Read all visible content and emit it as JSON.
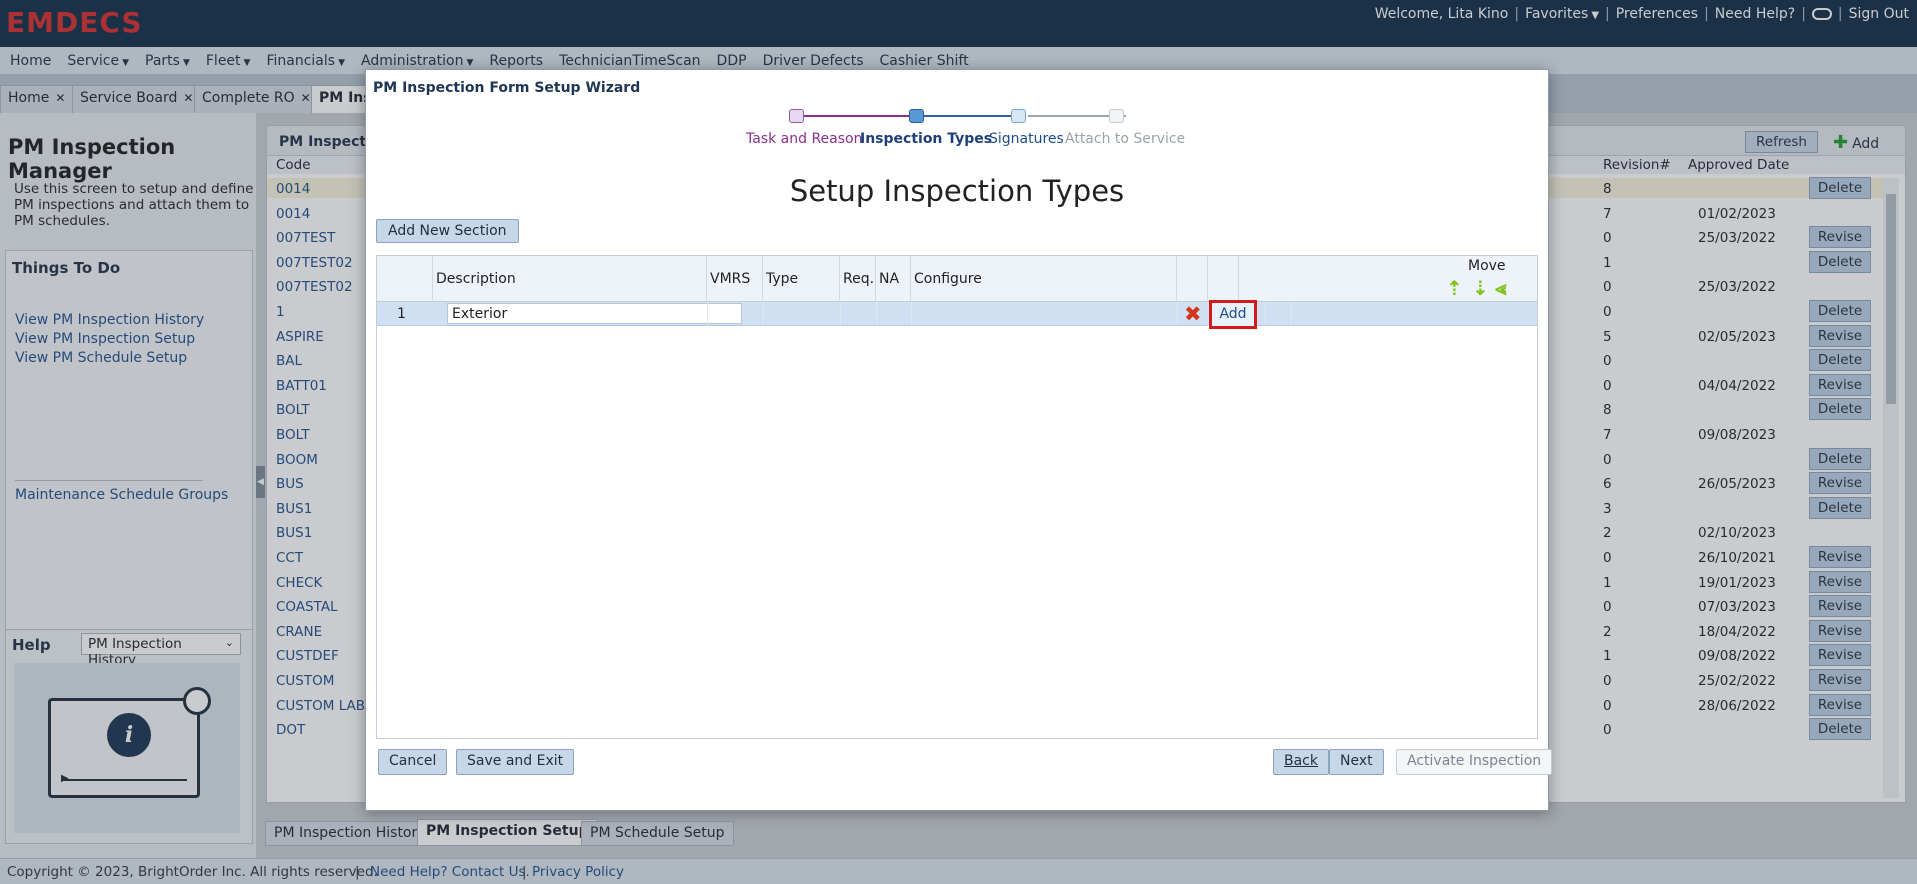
{
  "header": {
    "logo": "EMDECS",
    "welcome": "Welcome, Lita Kino",
    "favorites": "Favorites",
    "preferences": "Preferences",
    "need_help": "Need Help?",
    "sign_out": "Sign Out"
  },
  "menu": [
    {
      "label": "Home",
      "dropdown": false
    },
    {
      "label": "Service",
      "dropdown": true
    },
    {
      "label": "Parts",
      "dropdown": true
    },
    {
      "label": "Fleet",
      "dropdown": true
    },
    {
      "label": "Financials",
      "dropdown": true
    },
    {
      "label": "Administration",
      "dropdown": true
    },
    {
      "label": "Reports",
      "dropdown": false
    },
    {
      "label": "TechnicianTimeScan",
      "dropdown": false
    },
    {
      "label": "DDP",
      "dropdown": false
    },
    {
      "label": "Driver Defects",
      "dropdown": false
    },
    {
      "label": "Cashier Shift",
      "dropdown": false
    }
  ],
  "tabs": [
    {
      "label": "Home"
    },
    {
      "label": "Service Board"
    },
    {
      "label": "Complete RO"
    },
    {
      "label": "PM Ins"
    }
  ],
  "left": {
    "title": "PM Inspection Manager",
    "description": "Use this screen to setup and define PM inspections and attach them to PM schedules.",
    "things_to_do": "Things To Do",
    "links": [
      "View PM Inspection History",
      "View PM Inspection Setup",
      "View PM Schedule Setup"
    ],
    "extra_link": "Maintenance Schedule Groups",
    "help_label": "Help",
    "help_select": "PM Inspection History"
  },
  "right": {
    "title": "PM Inspecti",
    "refresh": "Refresh",
    "add": "Add",
    "col_code": "Code",
    "col_revision": "Revision#",
    "col_approved": "Approved Date",
    "rows": [
      {
        "code": "0014",
        "rev": "8",
        "date": "",
        "btn": "Delete"
      },
      {
        "code": "0014",
        "rev": "7",
        "date": "01/02/2023",
        "btn": ""
      },
      {
        "code": "007TEST",
        "rev": "0",
        "date": "25/03/2022",
        "btn": "Revise"
      },
      {
        "code": "007TEST02",
        "rev": "1",
        "date": "",
        "btn": "Delete"
      },
      {
        "code": "007TEST02",
        "rev": "0",
        "date": "25/03/2022",
        "btn": ""
      },
      {
        "code": "1",
        "rev": "0",
        "date": "",
        "btn": "Delete"
      },
      {
        "code": "ASPIRE",
        "rev": "5",
        "date": "02/05/2023",
        "btn": "Revise"
      },
      {
        "code": "BAL",
        "rev": "0",
        "date": "",
        "btn": "Delete"
      },
      {
        "code": "BATT01",
        "rev": "0",
        "date": "04/04/2022",
        "btn": "Revise"
      },
      {
        "code": "BOLT",
        "rev": "8",
        "date": "",
        "btn": "Delete"
      },
      {
        "code": "BOLT",
        "rev": "7",
        "date": "09/08/2023",
        "btn": ""
      },
      {
        "code": "BOOM",
        "rev": "0",
        "date": "",
        "btn": "Delete"
      },
      {
        "code": "BUS",
        "rev": "6",
        "date": "26/05/2023",
        "btn": "Revise"
      },
      {
        "code": "BUS1",
        "rev": "3",
        "date": "",
        "btn": "Delete"
      },
      {
        "code": "BUS1",
        "rev": "2",
        "date": "02/10/2023",
        "btn": ""
      },
      {
        "code": "CCT",
        "rev": "0",
        "date": "26/10/2021",
        "btn": "Revise"
      },
      {
        "code": "CHECK",
        "rev": "1",
        "date": "19/01/2023",
        "btn": "Revise"
      },
      {
        "code": "COASTAL",
        "rev": "0",
        "date": "07/03/2023",
        "btn": "Revise"
      },
      {
        "code": "CRANE",
        "rev": "2",
        "date": "18/04/2022",
        "btn": "Revise"
      },
      {
        "code": "CUSTDEF",
        "rev": "1",
        "date": "09/08/2022",
        "btn": "Revise"
      },
      {
        "code": "CUSTOM",
        "rev": "0",
        "date": "25/02/2022",
        "btn": "Revise"
      },
      {
        "code": "CUSTOM LABO",
        "rev": "0",
        "date": "28/06/2022",
        "btn": "Revise"
      },
      {
        "code": "DOT",
        "rev": "0",
        "date": "",
        "btn": "Delete"
      }
    ]
  },
  "bottom_tabs": [
    "PM Inspection History",
    "PM Inspection Setup",
    "PM Schedule Setup"
  ],
  "footer": {
    "copyright": "Copyright © 2023, BrightOrder Inc. All rights reserved.",
    "help_link": "Need Help? Contact Us.",
    "privacy": "Privacy Policy"
  },
  "modal": {
    "title": "PM Inspection Form Setup Wizard",
    "steps": [
      {
        "label": "Task and Reason",
        "state": "done"
      },
      {
        "label": "Inspection Types",
        "state": "current"
      },
      {
        "label": "Signatures",
        "state": "next"
      },
      {
        "label": "Attach to Service",
        "state": "disabled"
      }
    ],
    "heading": "Setup Inspection Types",
    "add_section": "Add New Section",
    "columns": {
      "description": "Description",
      "vmrs": "VMRS",
      "type": "Type",
      "req": "Req.",
      "na": "NA",
      "configure": "Configure",
      "move": "Move"
    },
    "row": {
      "num": "1",
      "description": "Exterior",
      "add": "Add"
    },
    "buttons": {
      "cancel": "Cancel",
      "save_exit": "Save and Exit",
      "back": "Back",
      "next": "Next",
      "activate": "Activate Inspection"
    }
  },
  "colors": {
    "header_bg": "#0f2a44",
    "logo": "#d62a2a",
    "highlight": "#d41b1b",
    "move_arrows": "#7dc21b",
    "delete_x": "#d4351c"
  }
}
